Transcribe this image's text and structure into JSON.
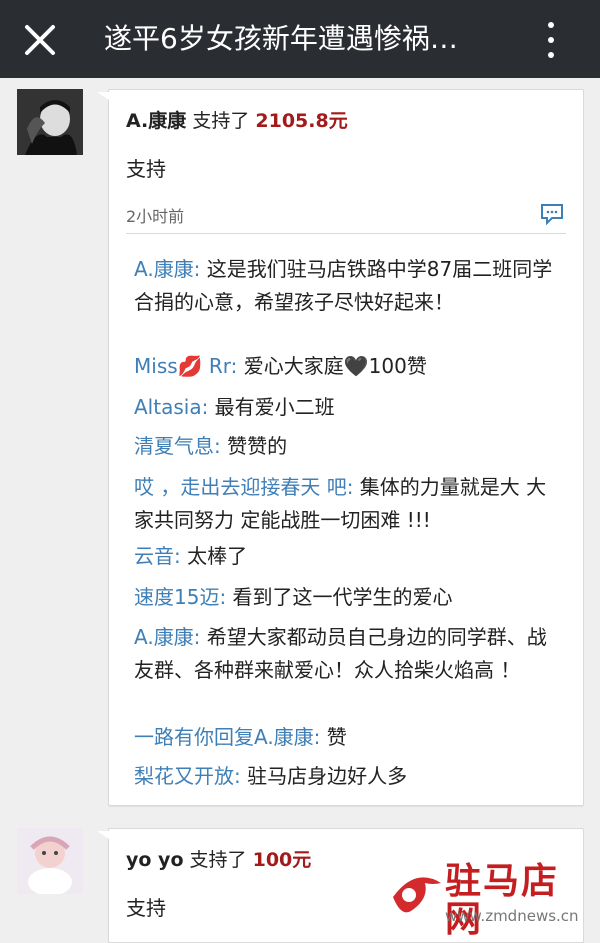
{
  "header": {
    "title": "遂平6岁女孩新年遭遇惨祸…"
  },
  "posts": [
    {
      "user": "A.康康",
      "action": "支持了",
      "amount": "2105.8元",
      "message": "支持",
      "time": "2小时前",
      "replies": [
        {
          "name": "A.康康:",
          "text": " 这是我们驻马店铁路中学87届二班同学合捐的心意，希望孩子尽快好起来！"
        },
        {
          "name": "Miss💋 Rr:",
          "text": " 爱心大家庭🖤100赞"
        },
        {
          "name": "Altasia:",
          "text": " 最有爱小二班"
        },
        {
          "name": "清夏气息:",
          "text": " 赞赞的"
        },
        {
          "name": "哎 ，走出去迎接春天 吧:",
          "text": " 集体的力量就是大 大家共同努力 定能战胜一切困难 !!!"
        },
        {
          "name": "云音:",
          "text": " 太棒了"
        },
        {
          "name": "速度15迈:",
          "text": " 看到了这一代学生的爱心"
        },
        {
          "name": "A.康康:",
          "text": " 希望大家都动员自己身边的同学群、战友群、各种群来献爱心！众人拾柴火焰高 ！"
        },
        {
          "name": "一路有你回复A.康康:",
          "text": " 赞"
        },
        {
          "name": "梨花又开放:",
          "text": " 驻马店身边好人多"
        }
      ]
    },
    {
      "user": "yo yo",
      "action": "支持了",
      "amount": "100元",
      "message": "支持"
    }
  ],
  "watermark": {
    "name": "驻马店网",
    "url": "www.zmdnews.cn"
  },
  "colors": {
    "topbar": "#2a2d31",
    "link": "#3f7fb7",
    "amount": "#a31a1a",
    "watermark": "#c41e20"
  },
  "icons": [
    "close-icon",
    "more-vertical-icon",
    "comment-icon"
  ]
}
